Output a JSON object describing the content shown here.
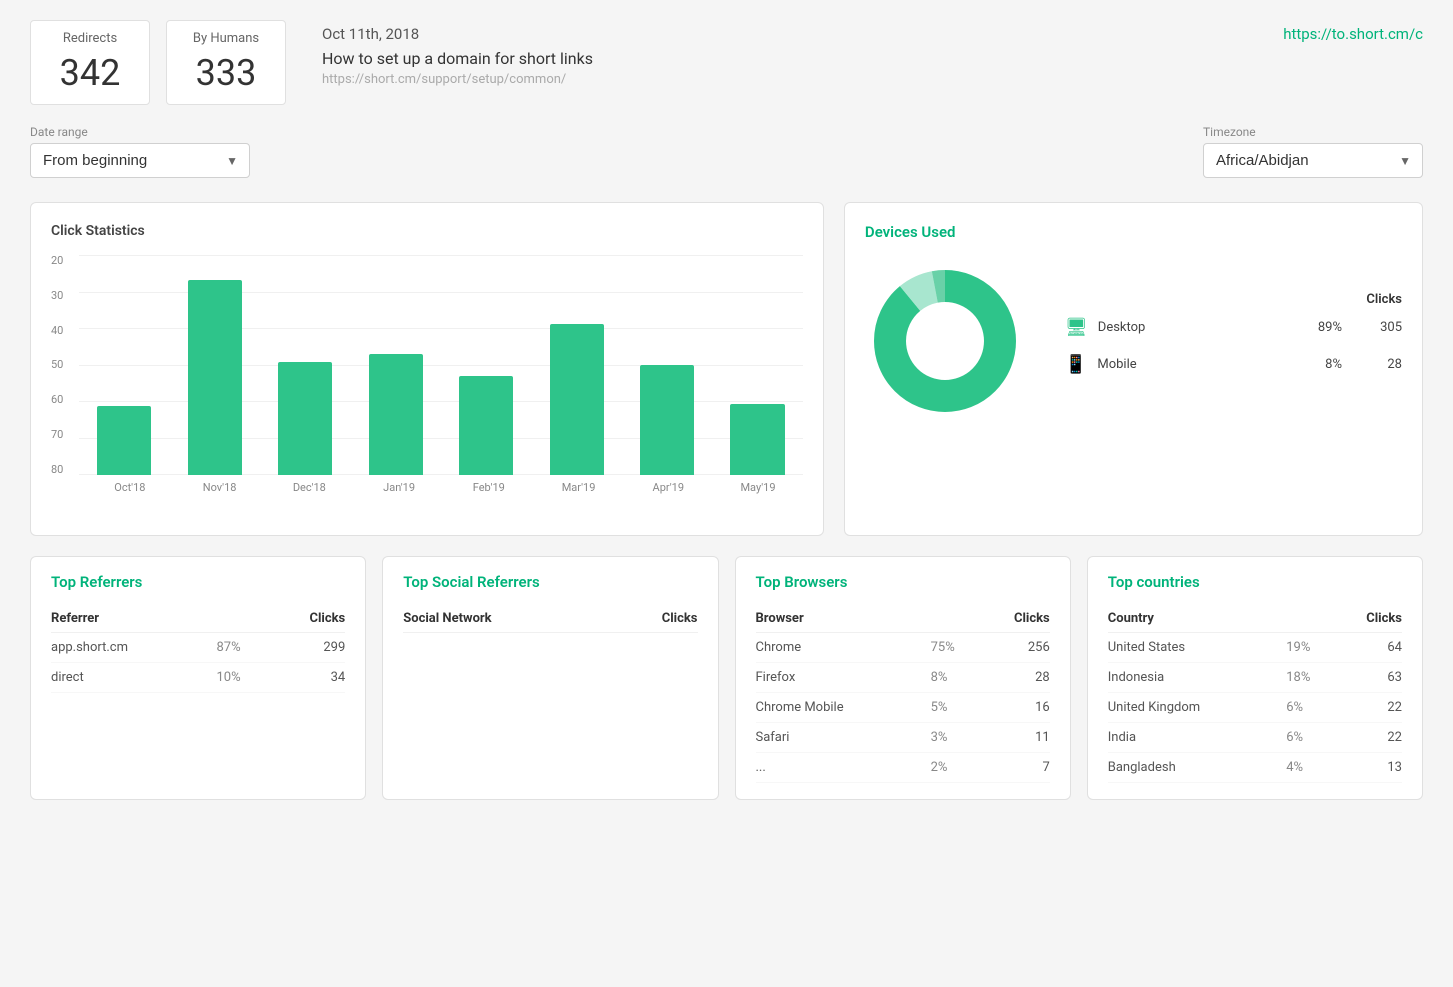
{
  "header": {
    "redirects_label": "Redirects",
    "redirects_value": "342",
    "humans_label": "By Humans",
    "humans_value": "333",
    "date": "Oct 11th, 2018",
    "link_title": "How to set up a domain for short links",
    "link_url": "https://short.cm/support/setup/common/",
    "dashboard_link": "https://to.short.cm/c"
  },
  "filters": {
    "date_range_label": "Date range",
    "date_range_value": "From beginning",
    "timezone_label": "Timezone",
    "timezone_value": "Africa/Abidjan"
  },
  "click_statistics": {
    "title": "Click Statistics",
    "y_axis": [
      "80",
      "70",
      "60",
      "50",
      "40",
      "30",
      "20"
    ],
    "bars": [
      {
        "label": "Oct'18",
        "value": 25,
        "height_pct": 31
      },
      {
        "label": "Nov'18",
        "value": 71,
        "height_pct": 89
      },
      {
        "label": "Dec'18",
        "value": 41,
        "height_pct": 51
      },
      {
        "label": "Jan'19",
        "value": 44,
        "height_pct": 55
      },
      {
        "label": "Feb'19",
        "value": 36,
        "height_pct": 45
      },
      {
        "label": "Mar'19",
        "value": 55,
        "height_pct": 69
      },
      {
        "label": "Apr'19",
        "value": 40,
        "height_pct": 50
      },
      {
        "label": "May'19",
        "value": 26,
        "height_pct": 33
      }
    ],
    "max_value": 80
  },
  "devices": {
    "title": "Devices Used",
    "clicks_header": "Clicks",
    "items": [
      {
        "icon": "desktop",
        "name": "Desktop",
        "pct": "89%",
        "clicks": "305"
      },
      {
        "icon": "mobile",
        "name": "Mobile",
        "pct": "8%",
        "clicks": "28"
      }
    ],
    "donut": {
      "desktop_pct": 89,
      "mobile_pct": 8,
      "other_pct": 3
    }
  },
  "top_referrers": {
    "title": "Top Referrers",
    "col_referrer": "Referrer",
    "col_clicks": "Clicks",
    "rows": [
      {
        "name": "app.short.cm",
        "pct": "87%",
        "clicks": "299"
      },
      {
        "name": "direct",
        "pct": "10%",
        "clicks": "34"
      }
    ]
  },
  "top_social": {
    "title": "Top Social Referrers",
    "col_network": "Social Network",
    "col_clicks": "Clicks",
    "rows": []
  },
  "top_browsers": {
    "title": "Top Browsers",
    "col_browser": "Browser",
    "col_clicks": "Clicks",
    "rows": [
      {
        "name": "Chrome",
        "pct": "75%",
        "clicks": "256"
      },
      {
        "name": "Firefox",
        "pct": "8%",
        "clicks": "28"
      },
      {
        "name": "Chrome Mobile",
        "pct": "5%",
        "clicks": "16"
      },
      {
        "name": "Safari",
        "pct": "3%",
        "clicks": "11"
      },
      {
        "name": "...",
        "pct": "2%",
        "clicks": "7"
      }
    ]
  },
  "top_countries": {
    "title": "Top countries",
    "col_country": "Country",
    "col_clicks": "Clicks",
    "rows": [
      {
        "name": "United States",
        "pct": "19%",
        "clicks": "64"
      },
      {
        "name": "Indonesia",
        "pct": "18%",
        "clicks": "63"
      },
      {
        "name": "United Kingdom",
        "pct": "6%",
        "clicks": "22"
      },
      {
        "name": "India",
        "pct": "6%",
        "clicks": "22"
      },
      {
        "name": "Bangladesh",
        "pct": "4%",
        "clicks": "13"
      }
    ]
  }
}
